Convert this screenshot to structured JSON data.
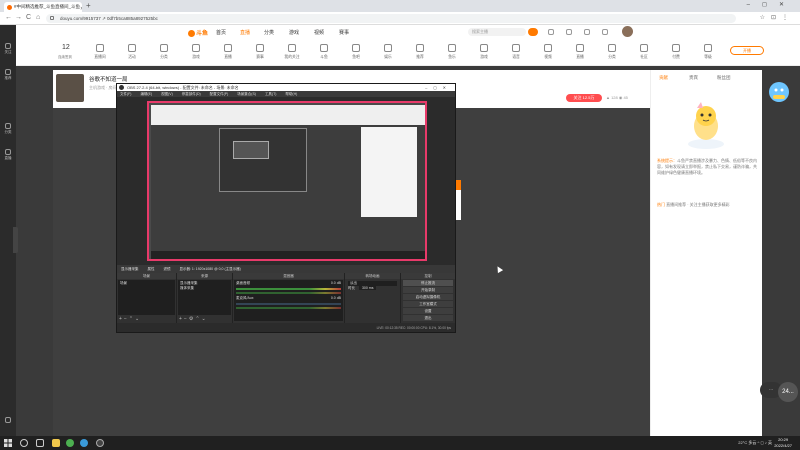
{
  "browser": {
    "tab_title": "#中间精选推荐_斗鱼直播间_斗鱼",
    "url": "douyu.com/9915737 ↗ 0df7b5ca885a8927525bc",
    "nav": {
      "back": "←",
      "forward": "→",
      "reload": "C",
      "home": "⌂"
    }
  },
  "site": {
    "logo": "斗鱼",
    "nav": [
      {
        "label": "首页",
        "active": false
      },
      {
        "label": "直播",
        "active": true
      },
      {
        "label": "分类",
        "active": false
      },
      {
        "label": "游戏",
        "active": false
      },
      {
        "label": "视频",
        "active": false
      },
      {
        "label": "赛事",
        "active": false
      }
    ],
    "search_placeholder": "搜索主播",
    "streak_count": "12",
    "streak_label": "连续签到",
    "tools": [
      "直播间",
      "活动",
      "分类",
      "游戏",
      "直播",
      "赛事",
      "我的关注",
      "斗鱼",
      "鱼吧",
      "娱乐",
      "推荐",
      "鱼乐",
      "游戏",
      "语音",
      "视频",
      "直播",
      "分类",
      "社区",
      "付费",
      "等级"
    ],
    "open_live_label": "开播",
    "rail": [
      {
        "label": "关注"
      },
      {
        "label": "推荐"
      },
      {
        "label": "分类"
      },
      {
        "label": "直播"
      }
    ]
  },
  "room": {
    "title": "谷歌不知道一局",
    "tag": "主机游戏 · 房间 9915737",
    "follow_label": "关注 12.5万",
    "stats": "▲ 128   ◉ 45"
  },
  "chat": {
    "tabs": [
      {
        "label": "贡献",
        "active": true
      },
      {
        "label": "贵宾",
        "active": false
      },
      {
        "label": "粉丝团",
        "active": false
      }
    ],
    "lines": [
      {
        "tag": "系统提示：",
        "text": "斗鱼严禁直播涉及暴力、色情、低俗等不良内容，如有发现请立即举报，禁止私下交易，谨防诈骗，共同维护绿色健康直播环境。"
      },
      {
        "tag": "热门",
        "text": "直播间推荐 · 关注主播获取更多精彩"
      }
    ],
    "float_label": "24..."
  },
  "obs": {
    "title": "OBS 27.2.4 (64-bit, windows) - 配置文件: 未命名 - 场景: 未命名",
    "menu": [
      "文件(F)",
      "编辑(E)",
      "视图(V)",
      "停靠部件(D)",
      "配置文件(P)",
      "场景集合(S)",
      "工具(T)",
      "帮助(H)"
    ],
    "toolbar": [
      "显示器采集",
      "属性",
      "滤镜",
      "显示器: 1: 1920x1080 @ 0,0 (主显示器)"
    ],
    "docks": {
      "scenes_title": "场景",
      "scenes": [
        "场景"
      ],
      "sources_title": "来源",
      "sources": [
        "显示器采集",
        "媒体采集"
      ],
      "mixer_title": "混音器",
      "mixer": [
        {
          "name": "桌面音频",
          "db": "0.0 dB"
        },
        {
          "name": "麦克风/Aux",
          "db": "0.0 dB"
        }
      ],
      "transitions_title": "转场动画",
      "transition_type": "淡出",
      "duration_label": "时长",
      "duration_value": "300 ms",
      "controls_title": "控制",
      "controls": [
        "停止推流",
        "开始录制",
        "启动虚拟摄像机",
        "工作室模式",
        "设置",
        "退出"
      ]
    },
    "status": "LIVE: 00:12:35   REC: 00:00:00   CPU: 8.1%, 30.00 fps"
  },
  "taskbar": {
    "weather": "22°C 多云",
    "tray": "^ ◻ ♪ 英",
    "time": "20:29",
    "date": "2022/4/27"
  },
  "colors": {
    "brand": "#ff7a00",
    "obs_border": "#e83a6a",
    "follow": "#ff4d4f"
  }
}
